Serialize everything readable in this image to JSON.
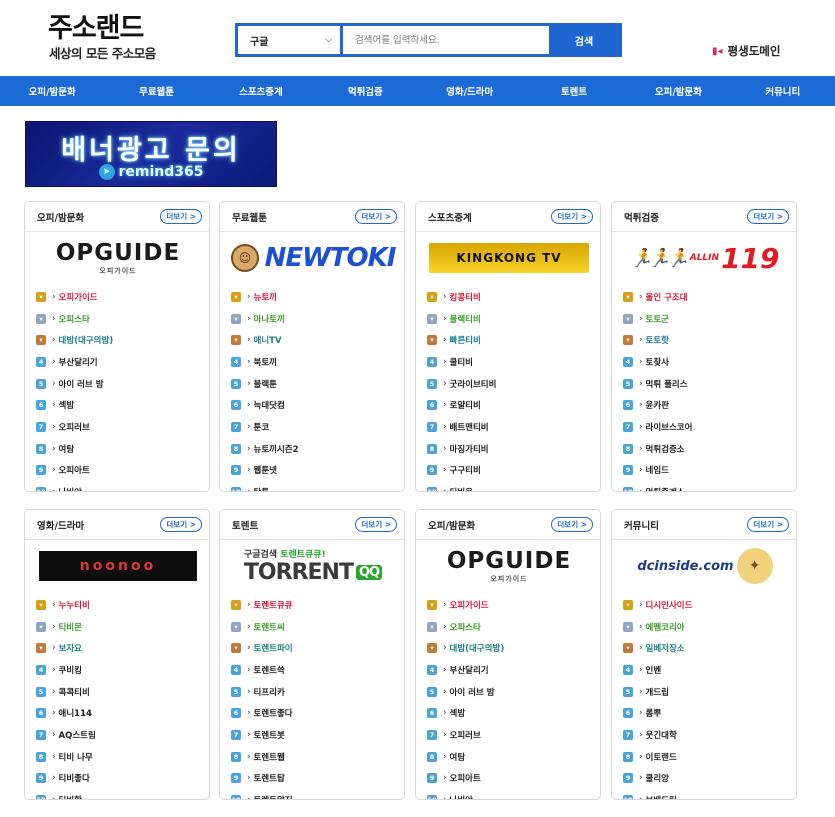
{
  "site": {
    "title": "주소랜드",
    "subtitle": "세상의 모든 주소모음"
  },
  "search": {
    "engine": "구글",
    "placeholder": "검색어를 입력하세요.",
    "button": "검색"
  },
  "permanent_domain": "평생도메인",
  "nav": [
    "오피/밤문화",
    "무료웹툰",
    "스포츠중계",
    "먹튀검증",
    "영화/드라마",
    "토렌트",
    "오피/밤문화",
    "커뮤니티"
  ],
  "banner": {
    "title": "배너광고 문의",
    "handle": "remind365"
  },
  "more_label": "더보기 >",
  "cards": [
    {
      "title": "오피/밤문화",
      "logo": "OPGUIDE",
      "logo_sub": "오피가이드",
      "items": [
        "오피가이드",
        "오피스타",
        "대밤(대구의밤)",
        "부산달리기",
        "아이 러브 밤",
        "섹밤",
        "오피러브",
        "여탐",
        "오피아트",
        "나비야"
      ]
    },
    {
      "title": "무료웹툰",
      "logo": "NEWTOKI",
      "items": [
        "뉴토끼",
        "마나토끼",
        "애니TV",
        "북토끼",
        "블랙툰",
        "늑대닷컴",
        "툰코",
        "뉴토끼시즌2",
        "웹툰넷",
        "탐툰"
      ]
    },
    {
      "title": "스포츠중계",
      "logo": "KINGKONG TV",
      "items": [
        "킹콩티비",
        "블랙티비",
        "빠른티비",
        "쿨티비",
        "굿라이브티비",
        "로얄티비",
        "배트맨티비",
        "마징가티비",
        "구구티비",
        "티비온"
      ]
    },
    {
      "title": "먹튀검증",
      "logo": "119",
      "logo_prefix": "ALLIN",
      "items": [
        "올인 구조대",
        "토토군",
        "토토핫",
        "토찾사",
        "먹튀 폴리스",
        "윤카판",
        "라이브스코어",
        "먹튀검증소",
        "네임드",
        "먹튀중계소"
      ]
    },
    {
      "title": "영화/드라마",
      "logo": "noonoo",
      "items": [
        "누누티비",
        "티비몬",
        "보자요",
        "쿠비킹",
        "콕콕티비",
        "애니114",
        "AQ스트림",
        "티비 나무",
        "티비좋다",
        "티비핫"
      ]
    },
    {
      "title": "토렌트",
      "logo": "TORRENT",
      "logo_line1": "구글검색",
      "logo_line1_highlight": "토렌트큐큐!",
      "logo_badge": "QQ",
      "items": [
        "토렌트큐큐",
        "토렌트씨",
        "토렌트파이",
        "토렌트쓱",
        "티프리카",
        "토렌트좋다",
        "토렌트봇",
        "토렌트웹",
        "토렌트탑",
        "토렌트알지"
      ]
    },
    {
      "title": "오피/밤문화",
      "logo": "OPGUIDE",
      "logo_sub": "오피가이드",
      "items": [
        "오피가이드",
        "오피스타",
        "대밤(대구의밤)",
        "부산달리기",
        "아이 러브 밤",
        "섹밤",
        "오피러브",
        "여탐",
        "오피아트",
        "나비야"
      ]
    },
    {
      "title": "커뮤니티",
      "logo": "dcinside.com",
      "items": [
        "디시인사이드",
        "에펨코리아",
        "일베저장소",
        "인벤",
        "개드립",
        "롬뿌",
        "웃긴대학",
        "이토랜드",
        "쿨리앙",
        "보배드림"
      ]
    }
  ]
}
